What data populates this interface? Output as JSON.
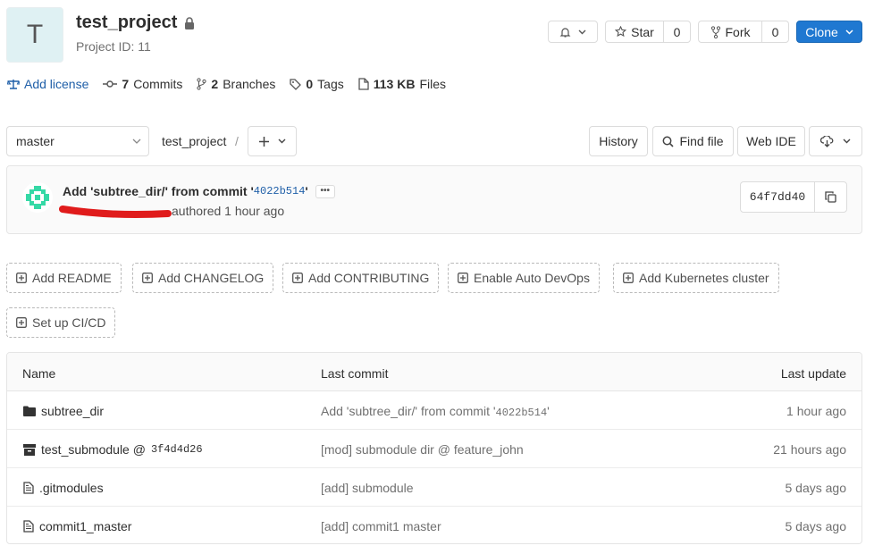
{
  "project": {
    "avatar_letter": "T",
    "name": "test_project",
    "id_text": "Project ID: 11"
  },
  "header_actions": {
    "star_label": "Star",
    "star_count": "0",
    "fork_label": "Fork",
    "fork_count": "0",
    "clone_label": "Clone"
  },
  "stats": {
    "license_label": "Add license",
    "commits_count": "7",
    "commits_label": "Commits",
    "branches_count": "2",
    "branches_label": "Branches",
    "tags_count": "0",
    "tags_label": "Tags",
    "files_size": "113 KB",
    "files_label": "Files"
  },
  "repo_nav": {
    "branch": "master",
    "breadcrumb": "test_project",
    "separator": "/",
    "history_label": "History",
    "find_file_label": "Find file",
    "web_ide_label": "Web IDE"
  },
  "last_commit": {
    "title_prefix": "Add 'subtree_dir/' from commit '",
    "title_sha": "4022b514",
    "title_suffix": "'",
    "more_label": "•••",
    "authored_text": "authored 1 hour ago",
    "short_sha": "64f7dd40"
  },
  "actions": [
    "Add README",
    "Add CHANGELOG",
    "Add CONTRIBUTING",
    "Enable Auto DevOps",
    "Add Kubernetes cluster",
    "Set up CI/CD"
  ],
  "file_table": {
    "headers": {
      "name": "Name",
      "last_commit": "Last commit",
      "last_update": "Last update"
    },
    "rows": [
      {
        "name": "subtree_dir",
        "suffix": "",
        "commit_prefix": "Add 'subtree_dir/' from commit '",
        "commit_sha": "4022b514",
        "commit_suffix": "'",
        "updated": "1 hour ago"
      },
      {
        "name": "test_submodule @ ",
        "suffix": "3f4d4d26",
        "commit_prefix": "[mod] submodule dir @ feature_john",
        "commit_sha": "",
        "commit_suffix": "",
        "updated": "21 hours ago"
      },
      {
        "name": ".gitmodules",
        "suffix": "",
        "commit_prefix": "[add] submodule",
        "commit_sha": "",
        "commit_suffix": "",
        "updated": "5 days ago"
      },
      {
        "name": "commit1_master",
        "suffix": "",
        "commit_prefix": "[add] commit1 master",
        "commit_sha": "",
        "commit_suffix": "",
        "updated": "5 days ago"
      }
    ]
  },
  "colors": {
    "primary": "#1f78d1",
    "link": "#1f5fa8",
    "avatar_bg": "#dff1f3",
    "redaction": "#e01b1b"
  }
}
